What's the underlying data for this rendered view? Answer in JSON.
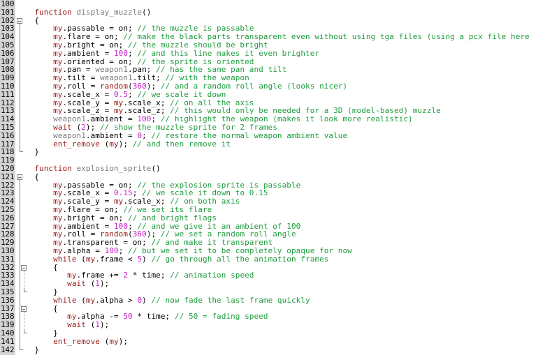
{
  "editor": {
    "name": "code-editor",
    "language": "C-Script / Lite-C",
    "first_line": 100,
    "last_line": 142,
    "gutter_bg": "#d4d4d4",
    "background": "#ffffff",
    "colors": {
      "keyword": "#9b1c1c",
      "identifier": "#000000",
      "function_name": "#7a7a7a",
      "number": "#cc1ecc",
      "comment": "#1f9e3f",
      "line_number": "#000000",
      "fold_line": "#808080"
    }
  },
  "lines": [
    {
      "num": "100",
      "fold": "none",
      "tokens": []
    },
    {
      "num": "101",
      "fold": "none",
      "tokens": [
        {
          "t": "  ",
          "c": "t-pun"
        },
        {
          "t": "function",
          "c": "t-kw"
        },
        {
          "t": " ",
          "c": "t-pun"
        },
        {
          "t": "display_muzzle",
          "c": "t-fn"
        },
        {
          "t": "()",
          "c": "t-pun"
        }
      ]
    },
    {
      "num": "102",
      "fold": "start",
      "tokens": [
        {
          "t": "  {",
          "c": "t-pun"
        }
      ]
    },
    {
      "num": "103",
      "fold": "bar",
      "tokens": [
        {
          "t": "      ",
          "c": "t-pun"
        },
        {
          "t": "my",
          "c": "t-kw"
        },
        {
          "t": ".passable = on; ",
          "c": "t-id"
        },
        {
          "t": "// the muzzle is passable",
          "c": "t-cmt"
        }
      ]
    },
    {
      "num": "104",
      "fold": "bar",
      "tokens": [
        {
          "t": "      ",
          "c": "t-pun"
        },
        {
          "t": "my",
          "c": "t-kw"
        },
        {
          "t": ".flare = on; ",
          "c": "t-id"
        },
        {
          "t": "// make the black parts transparent even without using tga files (using a pcx file here",
          "c": "t-cmt"
        }
      ]
    },
    {
      "num": "105",
      "fold": "bar",
      "tokens": [
        {
          "t": "      ",
          "c": "t-pun"
        },
        {
          "t": "my",
          "c": "t-kw"
        },
        {
          "t": ".bright = on; ",
          "c": "t-id"
        },
        {
          "t": "// the muzzle should be bright",
          "c": "t-cmt"
        }
      ]
    },
    {
      "num": "106",
      "fold": "bar",
      "tokens": [
        {
          "t": "      ",
          "c": "t-pun"
        },
        {
          "t": "my",
          "c": "t-kw"
        },
        {
          "t": ".ambient = ",
          "c": "t-id"
        },
        {
          "t": "100",
          "c": "t-num"
        },
        {
          "t": "; ",
          "c": "t-id"
        },
        {
          "t": "// and this line makes it even brighter",
          "c": "t-cmt"
        }
      ]
    },
    {
      "num": "107",
      "fold": "bar",
      "tokens": [
        {
          "t": "      ",
          "c": "t-pun"
        },
        {
          "t": "my",
          "c": "t-kw"
        },
        {
          "t": ".oriented = on; ",
          "c": "t-id"
        },
        {
          "t": "// the sprite is oriented",
          "c": "t-cmt"
        }
      ]
    },
    {
      "num": "108",
      "fold": "bar",
      "tokens": [
        {
          "t": "      ",
          "c": "t-pun"
        },
        {
          "t": "my",
          "c": "t-kw"
        },
        {
          "t": ".pan = ",
          "c": "t-id"
        },
        {
          "t": "weapon1",
          "c": "t-fn"
        },
        {
          "t": ".pan; ",
          "c": "t-id"
        },
        {
          "t": "// has the same pan and tilt",
          "c": "t-cmt"
        }
      ]
    },
    {
      "num": "109",
      "fold": "bar",
      "tokens": [
        {
          "t": "      ",
          "c": "t-pun"
        },
        {
          "t": "my",
          "c": "t-kw"
        },
        {
          "t": ".tilt = ",
          "c": "t-id"
        },
        {
          "t": "weapon1",
          "c": "t-fn"
        },
        {
          "t": ".tilt; ",
          "c": "t-id"
        },
        {
          "t": "// with the weapon",
          "c": "t-cmt"
        }
      ]
    },
    {
      "num": "110",
      "fold": "bar",
      "tokens": [
        {
          "t": "      ",
          "c": "t-pun"
        },
        {
          "t": "my",
          "c": "t-kw"
        },
        {
          "t": ".roll = ",
          "c": "t-id"
        },
        {
          "t": "random",
          "c": "t-kw"
        },
        {
          "t": "(",
          "c": "t-id"
        },
        {
          "t": "360",
          "c": "t-num"
        },
        {
          "t": "); ",
          "c": "t-id"
        },
        {
          "t": "// and a random roll angle (looks nicer)",
          "c": "t-cmt"
        }
      ]
    },
    {
      "num": "111",
      "fold": "bar",
      "tokens": [
        {
          "t": "      ",
          "c": "t-pun"
        },
        {
          "t": "my",
          "c": "t-kw"
        },
        {
          "t": ".scale_x = ",
          "c": "t-id"
        },
        {
          "t": "0.5",
          "c": "t-num"
        },
        {
          "t": "; ",
          "c": "t-id"
        },
        {
          "t": "// we scale it down",
          "c": "t-cmt"
        }
      ]
    },
    {
      "num": "112",
      "fold": "bar",
      "tokens": [
        {
          "t": "      ",
          "c": "t-pun"
        },
        {
          "t": "my",
          "c": "t-kw"
        },
        {
          "t": ".scale_y = ",
          "c": "t-id"
        },
        {
          "t": "my",
          "c": "t-kw"
        },
        {
          "t": ".scale_x; ",
          "c": "t-id"
        },
        {
          "t": "// on all the axis",
          "c": "t-cmt"
        }
      ]
    },
    {
      "num": "113",
      "fold": "bar",
      "tokens": [
        {
          "t": "      ",
          "c": "t-pun"
        },
        {
          "t": "my",
          "c": "t-kw"
        },
        {
          "t": ".scale_z = ",
          "c": "t-id"
        },
        {
          "t": "my",
          "c": "t-kw"
        },
        {
          "t": ".scale_z; ",
          "c": "t-id"
        },
        {
          "t": "// this would only be needed for a 3D (model-based) muzzle",
          "c": "t-cmt"
        }
      ]
    },
    {
      "num": "114",
      "fold": "bar",
      "tokens": [
        {
          "t": "      ",
          "c": "t-pun"
        },
        {
          "t": "weapon1",
          "c": "t-fn"
        },
        {
          "t": ".ambient = ",
          "c": "t-id"
        },
        {
          "t": "100",
          "c": "t-num"
        },
        {
          "t": "; ",
          "c": "t-id"
        },
        {
          "t": "// highlight the weapon (makes it look more realistic)",
          "c": "t-cmt"
        }
      ]
    },
    {
      "num": "115",
      "fold": "bar",
      "tokens": [
        {
          "t": "      ",
          "c": "t-pun"
        },
        {
          "t": "wait",
          "c": "t-kw"
        },
        {
          "t": " (",
          "c": "t-id"
        },
        {
          "t": "2",
          "c": "t-num"
        },
        {
          "t": "); ",
          "c": "t-id"
        },
        {
          "t": "// show the muzzle sprite for 2 frames",
          "c": "t-cmt"
        }
      ]
    },
    {
      "num": "116",
      "fold": "bar",
      "tokens": [
        {
          "t": "      ",
          "c": "t-pun"
        },
        {
          "t": "weapon1",
          "c": "t-fn"
        },
        {
          "t": ".ambient = ",
          "c": "t-id"
        },
        {
          "t": "0",
          "c": "t-num"
        },
        {
          "t": "; ",
          "c": "t-id"
        },
        {
          "t": "// restore the normal weapon ambient value",
          "c": "t-cmt"
        }
      ]
    },
    {
      "num": "117",
      "fold": "bar",
      "tokens": [
        {
          "t": "      ",
          "c": "t-pun"
        },
        {
          "t": "ent_remove",
          "c": "t-kw"
        },
        {
          "t": " (",
          "c": "t-id"
        },
        {
          "t": "my",
          "c": "t-kw"
        },
        {
          "t": "); ",
          "c": "t-id"
        },
        {
          "t": "// and then remove it",
          "c": "t-cmt"
        }
      ]
    },
    {
      "num": "118",
      "fold": "end",
      "tokens": [
        {
          "t": "  }",
          "c": "t-pun"
        }
      ]
    },
    {
      "num": "119",
      "fold": "none",
      "tokens": []
    },
    {
      "num": "120",
      "fold": "none",
      "tokens": [
        {
          "t": "  ",
          "c": "t-pun"
        },
        {
          "t": "function",
          "c": "t-kw"
        },
        {
          "t": " ",
          "c": "t-pun"
        },
        {
          "t": "explosion_sprite",
          "c": "t-fn"
        },
        {
          "t": "()",
          "c": "t-pun"
        }
      ]
    },
    {
      "num": "121",
      "fold": "start",
      "tokens": [
        {
          "t": "  {",
          "c": "t-pun"
        }
      ]
    },
    {
      "num": "122",
      "fold": "bar",
      "tokens": [
        {
          "t": "      ",
          "c": "t-pun"
        },
        {
          "t": "my",
          "c": "t-kw"
        },
        {
          "t": ".passable = on; ",
          "c": "t-id"
        },
        {
          "t": "// the explosion sprite is passable",
          "c": "t-cmt"
        }
      ]
    },
    {
      "num": "123",
      "fold": "bar",
      "tokens": [
        {
          "t": "      ",
          "c": "t-pun"
        },
        {
          "t": "my",
          "c": "t-kw"
        },
        {
          "t": ".scale_x = ",
          "c": "t-id"
        },
        {
          "t": "0.15",
          "c": "t-num"
        },
        {
          "t": "; ",
          "c": "t-id"
        },
        {
          "t": "// we scale it down to 0.15",
          "c": "t-cmt"
        }
      ]
    },
    {
      "num": "124",
      "fold": "bar",
      "tokens": [
        {
          "t": "      ",
          "c": "t-pun"
        },
        {
          "t": "my",
          "c": "t-kw"
        },
        {
          "t": ".scale_y = ",
          "c": "t-id"
        },
        {
          "t": "my",
          "c": "t-kw"
        },
        {
          "t": ".scale_x; ",
          "c": "t-id"
        },
        {
          "t": "// on both axis",
          "c": "t-cmt"
        }
      ]
    },
    {
      "num": "125",
      "fold": "bar",
      "tokens": [
        {
          "t": "      ",
          "c": "t-pun"
        },
        {
          "t": "my",
          "c": "t-kw"
        },
        {
          "t": ".flare = on; ",
          "c": "t-id"
        },
        {
          "t": "// we set its flare",
          "c": "t-cmt"
        }
      ]
    },
    {
      "num": "126",
      "fold": "bar",
      "tokens": [
        {
          "t": "      ",
          "c": "t-pun"
        },
        {
          "t": "my",
          "c": "t-kw"
        },
        {
          "t": ".bright = on; ",
          "c": "t-id"
        },
        {
          "t": "// and bright flags",
          "c": "t-cmt"
        }
      ]
    },
    {
      "num": "127",
      "fold": "bar",
      "tokens": [
        {
          "t": "      ",
          "c": "t-pun"
        },
        {
          "t": "my",
          "c": "t-kw"
        },
        {
          "t": ".ambient = ",
          "c": "t-id"
        },
        {
          "t": "100",
          "c": "t-num"
        },
        {
          "t": "; ",
          "c": "t-id"
        },
        {
          "t": "// and we give it an ambient of 100",
          "c": "t-cmt"
        }
      ]
    },
    {
      "num": "128",
      "fold": "bar",
      "tokens": [
        {
          "t": "      ",
          "c": "t-pun"
        },
        {
          "t": "my",
          "c": "t-kw"
        },
        {
          "t": ".roll = ",
          "c": "t-id"
        },
        {
          "t": "random",
          "c": "t-kw"
        },
        {
          "t": "(",
          "c": "t-id"
        },
        {
          "t": "360",
          "c": "t-num"
        },
        {
          "t": "); ",
          "c": "t-id"
        },
        {
          "t": "// we set a random roll angle",
          "c": "t-cmt"
        }
      ]
    },
    {
      "num": "129",
      "fold": "bar",
      "tokens": [
        {
          "t": "      ",
          "c": "t-pun"
        },
        {
          "t": "my",
          "c": "t-kw"
        },
        {
          "t": ".transparent = on; ",
          "c": "t-id"
        },
        {
          "t": "// and make it transparent",
          "c": "t-cmt"
        }
      ]
    },
    {
      "num": "130",
      "fold": "bar",
      "tokens": [
        {
          "t": "      ",
          "c": "t-pun"
        },
        {
          "t": "my",
          "c": "t-kw"
        },
        {
          "t": ".alpha = ",
          "c": "t-id"
        },
        {
          "t": "100",
          "c": "t-num"
        },
        {
          "t": "; ",
          "c": "t-id"
        },
        {
          "t": "// but we set it to be completely opaque for now",
          "c": "t-cmt"
        }
      ]
    },
    {
      "num": "131",
      "fold": "bar",
      "tokens": [
        {
          "t": "      ",
          "c": "t-pun"
        },
        {
          "t": "while",
          "c": "t-kw"
        },
        {
          "t": " (",
          "c": "t-id"
        },
        {
          "t": "my",
          "c": "t-kw"
        },
        {
          "t": ".frame < ",
          "c": "t-id"
        },
        {
          "t": "5",
          "c": "t-num"
        },
        {
          "t": ") ",
          "c": "t-id"
        },
        {
          "t": "// go through all the animation frames",
          "c": "t-cmt"
        }
      ]
    },
    {
      "num": "132",
      "fold": "start2",
      "tokens": [
        {
          "t": "      {",
          "c": "t-pun"
        }
      ]
    },
    {
      "num": "133",
      "fold": "bar2",
      "tokens": [
        {
          "t": "         ",
          "c": "t-pun"
        },
        {
          "t": "my",
          "c": "t-kw"
        },
        {
          "t": ".frame += ",
          "c": "t-id"
        },
        {
          "t": "2",
          "c": "t-num"
        },
        {
          "t": " * time; ",
          "c": "t-id"
        },
        {
          "t": "// animation speed",
          "c": "t-cmt"
        }
      ]
    },
    {
      "num": "134",
      "fold": "bar2",
      "tokens": [
        {
          "t": "         ",
          "c": "t-pun"
        },
        {
          "t": "wait",
          "c": "t-kw"
        },
        {
          "t": " (",
          "c": "t-id"
        },
        {
          "t": "1",
          "c": "t-num"
        },
        {
          "t": ");",
          "c": "t-id"
        }
      ]
    },
    {
      "num": "135",
      "fold": "end2",
      "tokens": [
        {
          "t": "      }",
          "c": "t-pun"
        }
      ]
    },
    {
      "num": "136",
      "fold": "bar",
      "tokens": [
        {
          "t": "      ",
          "c": "t-pun"
        },
        {
          "t": "while",
          "c": "t-kw"
        },
        {
          "t": " (",
          "c": "t-id"
        },
        {
          "t": "my",
          "c": "t-kw"
        },
        {
          "t": ".alpha > ",
          "c": "t-id"
        },
        {
          "t": "0",
          "c": "t-num"
        },
        {
          "t": ") ",
          "c": "t-id"
        },
        {
          "t": "// now fade the last frame quickly",
          "c": "t-cmt"
        }
      ]
    },
    {
      "num": "137",
      "fold": "start2",
      "tokens": [
        {
          "t": "      {",
          "c": "t-pun"
        }
      ]
    },
    {
      "num": "138",
      "fold": "bar2",
      "tokens": [
        {
          "t": "         ",
          "c": "t-pun"
        },
        {
          "t": "my",
          "c": "t-kw"
        },
        {
          "t": ".alpha -= ",
          "c": "t-id"
        },
        {
          "t": "50",
          "c": "t-num"
        },
        {
          "t": " * time; ",
          "c": "t-id"
        },
        {
          "t": "// 50 = fading speed",
          "c": "t-cmt"
        }
      ]
    },
    {
      "num": "139",
      "fold": "bar2",
      "tokens": [
        {
          "t": "         ",
          "c": "t-pun"
        },
        {
          "t": "wait",
          "c": "t-kw"
        },
        {
          "t": " (",
          "c": "t-id"
        },
        {
          "t": "1",
          "c": "t-num"
        },
        {
          "t": ");",
          "c": "t-id"
        }
      ]
    },
    {
      "num": "140",
      "fold": "end2",
      "tokens": [
        {
          "t": "      }",
          "c": "t-pun"
        }
      ]
    },
    {
      "num": "141",
      "fold": "bar",
      "tokens": [
        {
          "t": "      ",
          "c": "t-pun"
        },
        {
          "t": "ent_remove",
          "c": "t-kw"
        },
        {
          "t": " (",
          "c": "t-id"
        },
        {
          "t": "my",
          "c": "t-kw"
        },
        {
          "t": ");",
          "c": "t-id"
        }
      ]
    },
    {
      "num": "142",
      "fold": "end",
      "tokens": [
        {
          "t": "  }",
          "c": "t-pun"
        }
      ]
    }
  ]
}
